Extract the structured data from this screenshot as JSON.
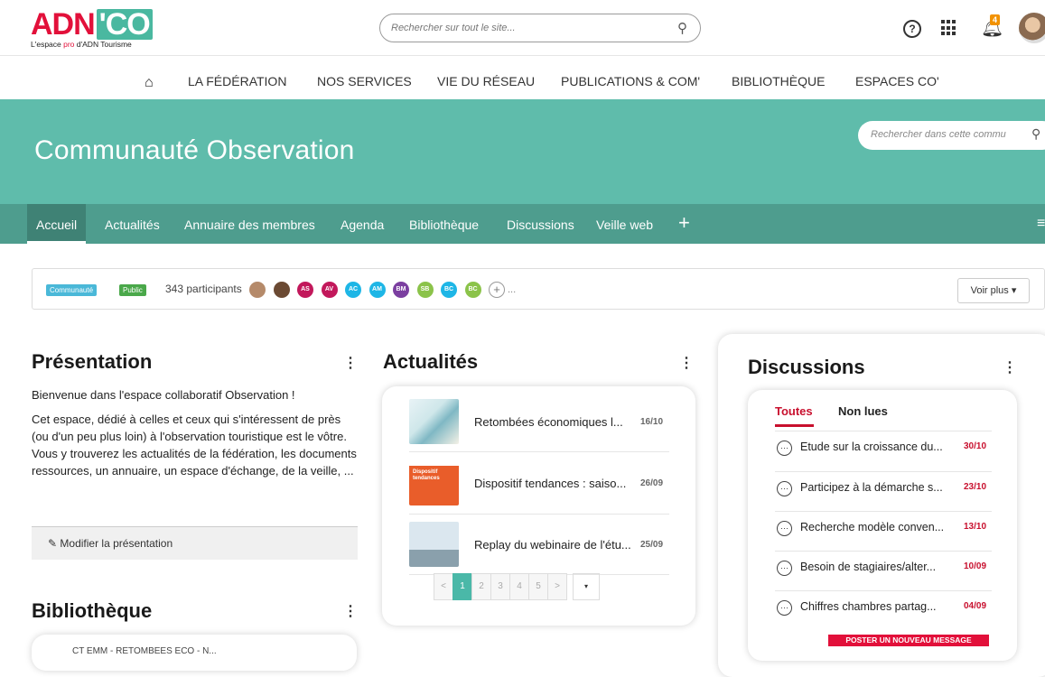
{
  "logo": {
    "brand_main": "ADN",
    "brand_co": "'CO",
    "tagline_before": "L'espace ",
    "tagline_pro": "pro",
    "tagline_after": " d'ADN Tourisme"
  },
  "header": {
    "search_placeholder": "Rechercher sur tout le site...",
    "help_symbol": "?",
    "notifications_count": "4"
  },
  "main_nav": {
    "items": [
      "LA FÉDÉRATION",
      "NOS SERVICES",
      "VIE DU RÉSEAU",
      "PUBLICATIONS & COM'",
      "BIBLIOTHÈQUE",
      "ESPACES CO'"
    ]
  },
  "banner": {
    "title": "Communauté Observation",
    "search_placeholder": "Rechercher dans cette commu"
  },
  "community_tabs": {
    "items": [
      "Accueil",
      "Actualités",
      "Annuaire des membres",
      "Agenda",
      "Bibliothèque",
      "Discussions",
      "Veille web"
    ],
    "active": "Accueil",
    "add": "+"
  },
  "info": {
    "badge_community": "Communauté",
    "badge_public": "Public",
    "participants": "343 participants",
    "avatars": [
      {
        "initials": "",
        "color": "#b58a6a"
      },
      {
        "initials": "",
        "color": "#6b4a33"
      },
      {
        "initials": "AS",
        "color": "#c2185b"
      },
      {
        "initials": "AV",
        "color": "#c2185b"
      },
      {
        "initials": "AC",
        "color": "#1eb6e6"
      },
      {
        "initials": "AM",
        "color": "#1eb6e6"
      },
      {
        "initials": "BM",
        "color": "#7b3fa0"
      },
      {
        "initials": "SB",
        "color": "#8bc34a"
      },
      {
        "initials": "BC",
        "color": "#1eb6e6"
      },
      {
        "initials": "BC",
        "color": "#8bc34a"
      }
    ],
    "more": "+",
    "ellipsis": "...",
    "voir_plus": "Voir plus ▾"
  },
  "presentation": {
    "title": "Présentation",
    "intro": "Bienvenue dans l'espace collaboratif Observation !",
    "body": "Cet espace, dédié à celles et ceux qui s'intéressent de près (ou d'un peu plus loin) à l'observation touristique est le vôtre. Vous y trouverez les actualités de la fédération, les documents ressources, un annuaire, un espace d'échange, de la veille, ...",
    "edit_label": "Modifier la présentation"
  },
  "actualites": {
    "title": "Actualités",
    "items": [
      {
        "title": "Retombées économiques l...",
        "date": "16/10"
      },
      {
        "title": "Dispositif tendances : saiso...",
        "date": "26/09"
      },
      {
        "title": "Replay du webinaire de l'étu...",
        "date": "25/09"
      }
    ],
    "thumb2_caption": "Dispositif tendances",
    "pager": {
      "prev": "<",
      "pages": [
        "1",
        "2",
        "3",
        "4",
        "5"
      ],
      "current": "1",
      "next": ">",
      "drop": "▾"
    }
  },
  "discussions": {
    "title": "Discussions",
    "tabs": [
      "Toutes",
      "Non lues"
    ],
    "items": [
      {
        "title": "Etude sur la croissance du...",
        "date": "30/10"
      },
      {
        "title": "Participez à la démarche s...",
        "date": "23/10"
      },
      {
        "title": "Recherche modèle conven...",
        "date": "13/10"
      },
      {
        "title": "Besoin de stagiaires/alter...",
        "date": "10/09"
      },
      {
        "title": "Chiffres chambres partag...",
        "date": "04/09"
      }
    ],
    "post_button": "POSTER UN NOUVEAU MESSAGE"
  },
  "bibliotheque": {
    "title": "Bibliothèque",
    "first_item": "CT EMM - RETOMBEES ECO - N..."
  },
  "colors": {
    "teal": "#5fbcab",
    "teal_dark": "#4e9d8e",
    "brand_red": "#e2103a",
    "discussion_red": "#c8102e"
  }
}
